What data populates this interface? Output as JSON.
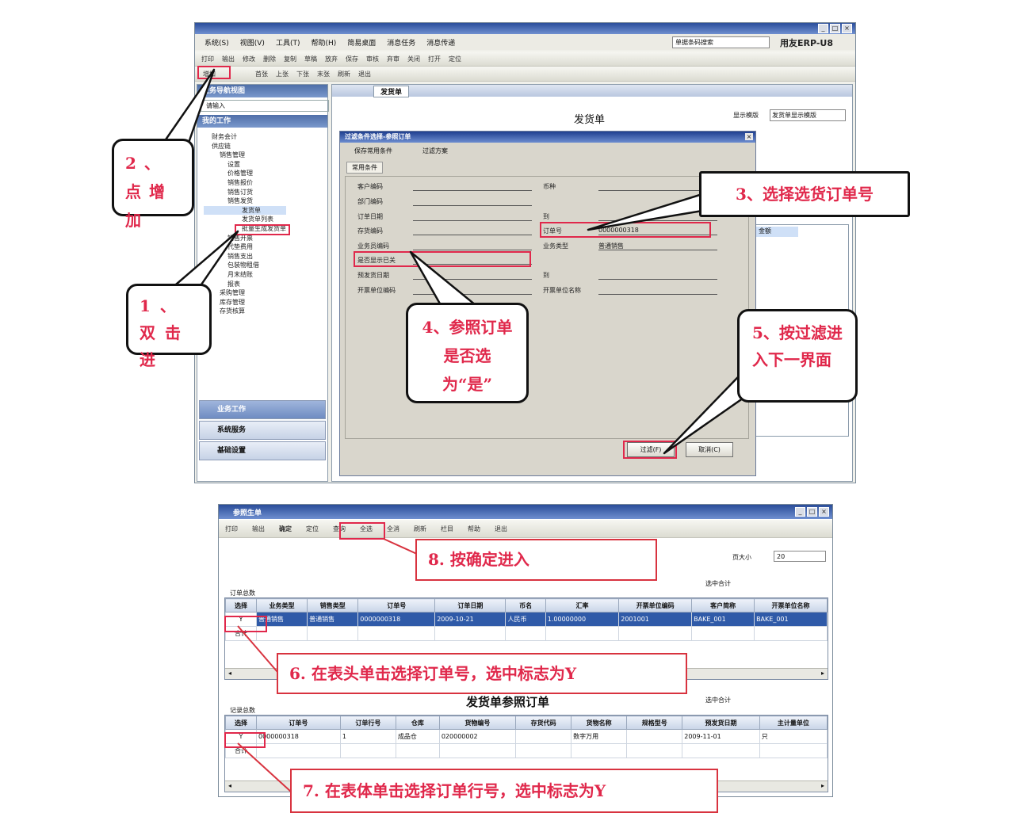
{
  "top_window": {
    "title": "",
    "menus": [
      "系统(S)",
      "视图(V)",
      "工具(T)",
      "帮助(H)",
      "简易桌面",
      "消息任务",
      "消息传递"
    ],
    "search_value": "单据条码搜索",
    "brand": "用友ERP-U8",
    "add_button": "增加",
    "toolbar_items": [
      "打印",
      "输出",
      "增加",
      "修改",
      "删除",
      "复制",
      "草稿",
      "放弃",
      "保存",
      "审核",
      "弃审",
      "关闭",
      "打开",
      "定位",
      "首张",
      "上张",
      "下张",
      "末张",
      "刷新",
      "退出"
    ],
    "nav_header": "业务导航视图",
    "nav_search": "请输入",
    "nav_sub": "我的工作",
    "tree": [
      "财务会计",
      "供应链",
      "销售管理",
      "设置",
      "价格管理",
      "销售报价",
      "销售订货",
      "销售发货",
      "发货单",
      "发货单列表",
      "批量生成发货单",
      "销售开票",
      "代垫费用",
      "销售支出",
      "包装物租借",
      "月末结账",
      "报表",
      "采购管理",
      "库存管理",
      "存货核算"
    ],
    "nav_buttons": [
      "业务工作",
      "系统服务",
      "基础设置"
    ],
    "tab_label": "发货单",
    "doc_title": "发货单",
    "template_label": "显示模版",
    "template_value": "发货单显示模版",
    "dialog": {
      "title": "过滤条件选择-参照订单",
      "tabs": [
        "保存常用条件",
        "过滤方案"
      ],
      "group": "常用条件",
      "left_labels": [
        "客户编码",
        "部门编码",
        "订单日期",
        "存货编码",
        "业务员编码",
        "是否显示已关",
        "预发货日期",
        "开票单位编码"
      ],
      "right_labels": [
        "币种",
        "到",
        "订单号",
        "业务类型",
        "到",
        "开票单位名称"
      ],
      "order_no": "0000000318",
      "biz_type": "普通销售",
      "ok_button": "过滤(F)",
      "cancel_button": "取消(C)",
      "right_panel_header": "金额"
    }
  },
  "bottom_window": {
    "title": "参照生单",
    "toolbar": [
      "打印",
      "输出",
      "确定",
      "定位",
      "查询",
      "全选",
      "全消",
      "刷新",
      "栏目",
      "帮助",
      "退出"
    ],
    "ok_button": "确定",
    "total_label": "页大小",
    "total_value": "20",
    "check_label_1": "选中合计",
    "check_label_2": "选中合计",
    "upper_section": "订单总数",
    "lower_section": "记录总数",
    "mid_title": "发货单参照订单",
    "upper_headers": [
      "选择",
      "业务类型",
      "销售类型",
      "订单号",
      "订单日期",
      "币名",
      "汇率",
      "开票单位编码",
      "客户简称",
      "开票单位名称"
    ],
    "upper_rows": [
      [
        "Y",
        "普通销售",
        "普通销售",
        "0000000318",
        "2009-10-21",
        "人民币",
        "1.00000000",
        "2001001",
        "BAKE_001",
        "BAKE_001"
      ]
    ],
    "upper_total": "合计",
    "lower_headers": [
      "选择",
      "订单号",
      "订单行号",
      "仓库",
      "货物编号",
      "存货代码",
      "货物名称",
      "规格型号",
      "预发货日期",
      "主计量单位"
    ],
    "lower_rows": [
      [
        "Y",
        "0000000318",
        "1",
        "成品仓",
        "020000002",
        "",
        "数字万用",
        "",
        "2009-11-01",
        "只"
      ]
    ],
    "lower_total": "合计"
  },
  "callouts": {
    "c1": "1、双击进",
    "c2": "2、点增加",
    "c3": "3、选择选货订单号",
    "c4": "4、参照订单是否选为“是”",
    "c5": "5、按过滤进入下一界面",
    "c6": "6. 在表头单击选择订单号，选中标志为Y",
    "c7": "7. 在表体单击选择订单行号，选中标志为Y",
    "c8": "8. 按确定进入"
  }
}
